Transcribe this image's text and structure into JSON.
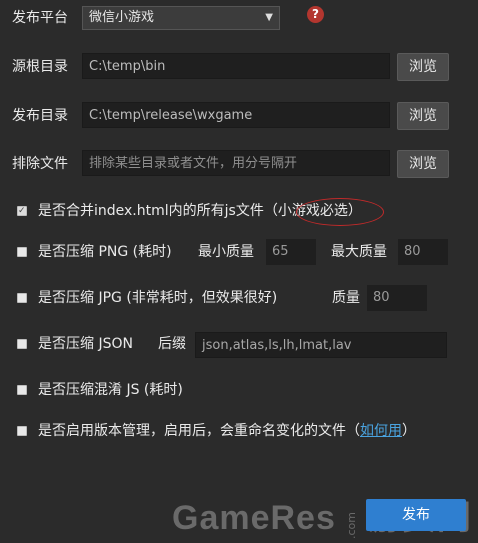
{
  "platform": {
    "label": "发布平台",
    "selected": "微信小游戏",
    "help": "?"
  },
  "source_dir": {
    "label": "源根目录",
    "value": "C:\\temp\\bin",
    "button": "浏览"
  },
  "publish_dir": {
    "label": "发布目录",
    "value": "C:\\temp\\release\\wxgame",
    "button": "浏览"
  },
  "exclude": {
    "label": "排除文件",
    "placeholder": "排除某些目录或者文件，用分号隔开",
    "button": "浏览"
  },
  "merge_js": {
    "label_pre": "是否合并index.html内的所有js文件（",
    "label_hl": "小游戏必选",
    "label_post": "）",
    "checked": true
  },
  "png": {
    "label": "是否压缩 PNG (耗时)",
    "min_label": "最小质量",
    "min_value": "65",
    "max_label": "最大质量",
    "max_value": "80",
    "checked": false
  },
  "jpg": {
    "label": "是否压缩 JPG (非常耗时，但效果很好)",
    "quality_label": "质量",
    "quality_value": "80",
    "checked": false
  },
  "json": {
    "label": "是否压缩 JSON",
    "suffix_label": "后缀",
    "suffix_value": "json,atlas,ls,lh,lmat,lav",
    "checked": false
  },
  "js": {
    "label": "是否压缩混淆 JS (耗时)",
    "checked": false
  },
  "version": {
    "label_pre": "是否启用版本管理，启用后，会重命名变化的文件（",
    "link": "如何用",
    "label_post": "）",
    "checked": false
  },
  "watermark": {
    "left": "GameRes",
    "dot": ".com",
    "right": "游资网"
  },
  "publish_button": "发布",
  "colors": {
    "accent": "#2f7fd0",
    "help": "#b3362f",
    "link": "#4aa3df"
  }
}
